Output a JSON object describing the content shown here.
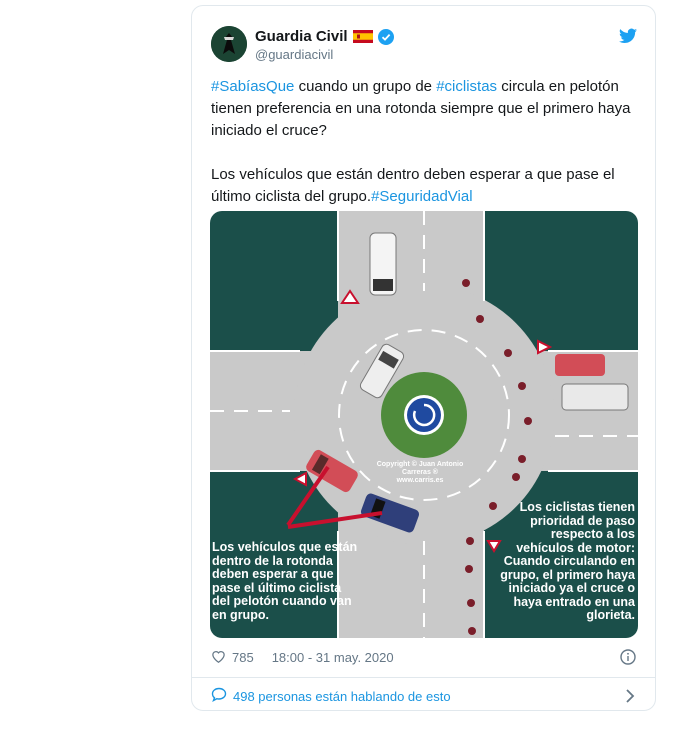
{
  "tweet": {
    "display_name": "Guardia Civil",
    "handle": "@guardiacivil",
    "paragraph1": {
      "tag1": "#SabíasQue",
      "text1": " cuando un grupo de ",
      "tag2": "#ciclistas",
      "text2": " circula en pelotón tienen preferencia en una rotonda siempre que el primero haya iniciado el cruce?"
    },
    "paragraph2": {
      "text1": "Los vehículos que están dentro deben esperar a que pase el último ciclista del grupo.",
      "tag1": "#SeguridadVial"
    },
    "likes": "785",
    "timestamp": "18:00 - 31 may. 2020",
    "talking": "498 personas están hablando de esto"
  },
  "image": {
    "copyright_line1": "Copyright © Juan Antonio Carreras ®",
    "copyright_line2": "www.carris.es",
    "left_caption": "Los vehículos que están dentro de la rotonda deben esperar a que pase el último ciclista del pelotón cuando van en grupo.",
    "right_caption": "Los ciclistas tienen prioridad de paso respecto a los vehículos de motor: Cuando circulando en grupo, el primero haya iniciado ya el cruce o haya entrado en una glorieta."
  },
  "colors": {
    "brand_blue": "#1b95e0",
    "grass_dark": "#1b4f4a",
    "road_gray": "#c9c9c9",
    "roundabout_green": "#4f8b3c",
    "sign_blue": "#1f4aa0"
  },
  "icons": [
    "verified-badge-icon",
    "spain-flag-icon",
    "twitter-bird-icon",
    "heart-icon",
    "info-icon",
    "comment-bubble-icon",
    "chevron-right-icon"
  ]
}
